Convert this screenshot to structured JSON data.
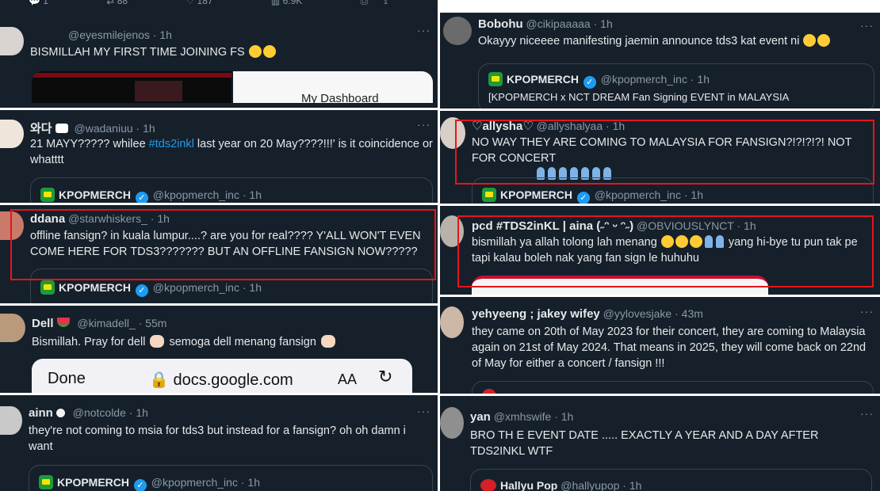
{
  "left": {
    "top_actions": {
      "replies": "1",
      "reposts": "88",
      "likes": "187",
      "views": "6.9K"
    },
    "tweets": [
      {
        "display_name": "",
        "handle": "@eyesmilejenos",
        "time": "1h",
        "text": "BISMILLAH MY FIRST TIME JOINING FS",
        "emoji": "sob-sob",
        "media_text": "My Dashboard"
      },
      {
        "display_name": "와다",
        "handle": "@wadaniuu",
        "time": "1h",
        "text_before": "21 MAYY????? whilee ",
        "hashtag": "#tds2inkl",
        "text_after": " last year on 20 May????!!!' is it coincidence or whatttt",
        "quote_name": "KPOPMERCH",
        "quote_handle": "@kpopmerch_inc",
        "quote_time": "1h"
      },
      {
        "display_name": "ddana",
        "handle": "@starwhiskers_",
        "time": "1h",
        "text": "offline fansign? in kuala lumpur....? are you for real???? Y'ALL WON'T EVEN COME HERE FOR TDS3??????? BUT AN OFFLINE FANSIGN NOW?????",
        "quote_name": "KPOPMERCH",
        "quote_handle": "@kpopmerch_inc",
        "quote_time": "1h"
      },
      {
        "display_name": "Dell",
        "handle": "@kimadell_",
        "time": "55m",
        "text_a": "Bismillah. Pray for dell",
        "text_b": " semoga dell menang fansign",
        "browser_done": "Done",
        "browser_url": "docs.google.com",
        "browser_aa": "AA"
      },
      {
        "display_name": "ainn",
        "handle": "@notcolde",
        "time": "1h",
        "text": "they're not coming to msia for tds3 but instead for a fansign? oh oh damn i want",
        "quote_name": "KPOPMERCH",
        "quote_handle": "@kpopmerch_inc",
        "quote_time": "1h"
      }
    ]
  },
  "right": {
    "tweets": [
      {
        "display_name": "Bobohu",
        "handle": "@cikipaaaaa",
        "time": "1h",
        "text": "Okayyy niceeee manifesting jaemin announce tds3 kat event ni",
        "quote_name": "KPOPMERCH",
        "quote_handle": "@kpopmerch_inc",
        "quote_time": "1h",
        "quote_text": "[KPOPMERCH x NCT DREAM Fan Signing EVENT in MALAYSIA"
      },
      {
        "display_name": "♡allysha♡",
        "handle": "@allyshalyaa",
        "time": "1h",
        "text": "NO WAY THEY ARE COMING TO MALAYSIA FOR FANSIGN?!?!?!?! NOT FOR CONCERT",
        "quote_name": "KPOPMERCH",
        "quote_handle": "@kpopmerch_inc",
        "quote_time": "1h"
      },
      {
        "display_name": "pcd #TDS2inKL | aina (˶ᵔ ᵕ ᵔ˶)",
        "handle": "@OBVIOUSLYNCT",
        "time": "1h",
        "text_a": "bismillah ya allah tolong lah menang",
        "text_b": " yang hi-bye tu pun tak pe tapi kalau boleh nak yang fan sign le huhuhu"
      },
      {
        "display_name": "yehyeeng ; jakey wifey",
        "handle": "@yylovesjake",
        "time": "43m",
        "text": "they came on 20th of May 2023 for their concert, they are coming to Malaysia again on 21st of May 2024. That means in 2025, they will come back on 22nd of May for either a concert / fansign !!!"
      },
      {
        "display_name": "yan",
        "handle": "@xmhswife",
        "time": "1h",
        "text": "BRO TH E EVENT DATE ..... EXACTLY A YEAR AND A DAY AFTER TDS2INKL WTF",
        "quote_name": "Hallyu Pop",
        "quote_handle": "@hallyupop",
        "quote_time": "1h"
      }
    ]
  },
  "colors": {
    "background": "#15202b",
    "text": "#e7e9ea",
    "muted": "#8b98a5",
    "link": "#1d9bf0",
    "highlight": "#e8141b"
  }
}
